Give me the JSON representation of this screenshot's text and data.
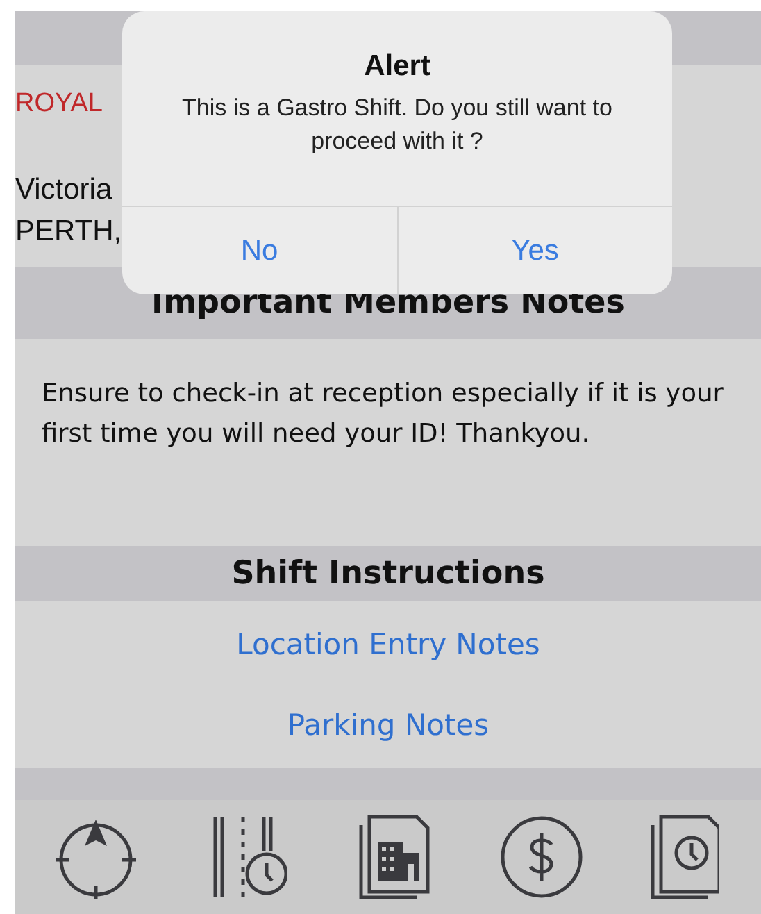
{
  "venue": {
    "name": "ROYAL",
    "address_lines": [
      "Victoria",
      "PERTH,"
    ]
  },
  "sections": [
    {
      "title": "Important Members Notes",
      "kind": "text",
      "body": "Ensure to check-in at reception especially if it is your first time you will need your ID! Thankyou."
    },
    {
      "title": "Shift Instructions",
      "kind": "links",
      "links": [
        "Location Entry Notes",
        "Parking Notes"
      ]
    }
  ],
  "tab_bar": {
    "items": [
      {
        "kind": "compass"
      },
      {
        "kind": "timeline"
      },
      {
        "kind": "building-document"
      },
      {
        "kind": "dollar"
      },
      {
        "kind": "clock-document"
      }
    ]
  },
  "alert": {
    "title": "Alert",
    "message": "This is a Gastro Shift. Do you still want to proceed with it ?",
    "buttons": [
      {
        "label": "No"
      },
      {
        "label": "Yes"
      }
    ]
  }
}
